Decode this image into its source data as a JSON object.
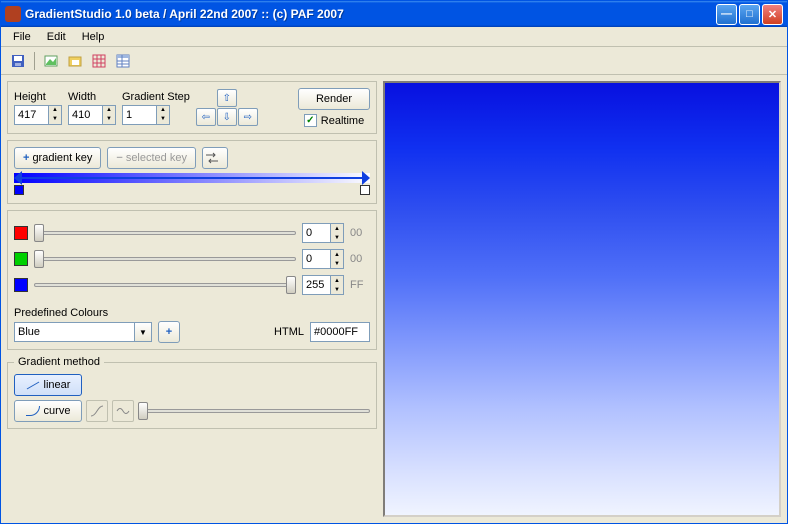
{
  "title": "GradientStudio 1.0 beta / April 22nd 2007 :: (c) PAF 2007",
  "menu": {
    "file": "File",
    "edit": "Edit",
    "help": "Help"
  },
  "dims": {
    "height_label": "Height",
    "height_value": "417",
    "width_label": "Width",
    "width_value": "410",
    "step_label": "Gradient Step",
    "step_value": "1"
  },
  "render": {
    "button": "Render",
    "realtime_label": "Realtime",
    "realtime_checked": true
  },
  "keys": {
    "add": "gradient key",
    "remove": "selected key"
  },
  "rgb": {
    "r": {
      "value": "0",
      "hex": "00",
      "color": "#ff0000",
      "pos": 0
    },
    "g": {
      "value": "0",
      "hex": "00",
      "color": "#00d000",
      "pos": 0
    },
    "b": {
      "value": "255",
      "hex": "FF",
      "color": "#0000ff",
      "pos": 100
    }
  },
  "predefined": {
    "label": "Predefined Colours",
    "value": "Blue"
  },
  "html_color": {
    "label": "HTML",
    "value": "#0000FF"
  },
  "method": {
    "label": "Gradient method",
    "linear": "linear",
    "curve": "curve"
  },
  "chart_data": {
    "type": "gradient",
    "direction": "vertical",
    "stops": [
      {
        "position": 0,
        "color": "#0000FF"
      },
      {
        "position": 100,
        "color": "#FFFFFF"
      }
    ],
    "preview_width": 410,
    "preview_height": 417
  }
}
